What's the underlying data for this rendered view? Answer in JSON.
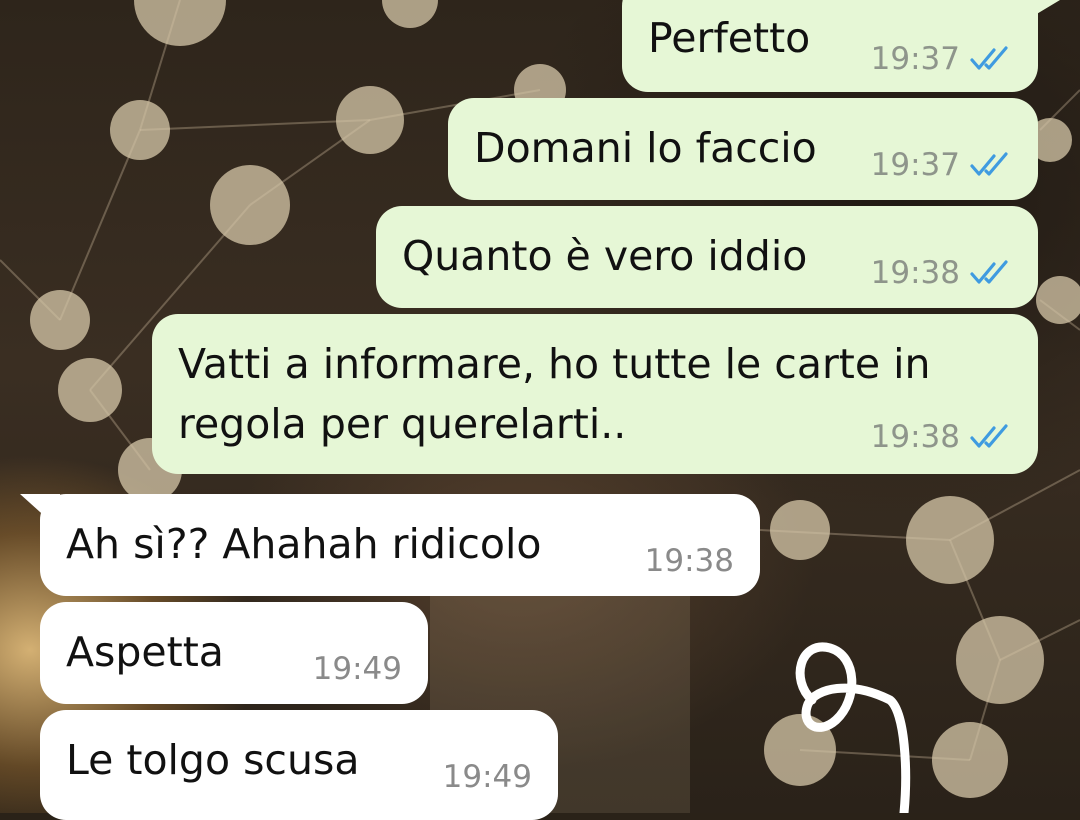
{
  "conversation": {
    "messages": [
      {
        "direction": "outgoing",
        "text": "Perfetto",
        "time": "19:37",
        "status": "read"
      },
      {
        "direction": "outgoing",
        "text": "Domani lo faccio",
        "time": "19:37",
        "status": "read"
      },
      {
        "direction": "outgoing",
        "text": "Quanto è vero iddio",
        "time": "19:38",
        "status": "read"
      },
      {
        "direction": "outgoing",
        "text_line1": "Vatti a informare, ho tutte le carte in",
        "text_line2": "regola per querelarti..",
        "time": "19:38",
        "status": "read"
      },
      {
        "direction": "incoming",
        "text": "Ah sì?? Ahahah ridicolo",
        "time": "19:38"
      },
      {
        "direction": "incoming",
        "text": "Aspetta",
        "time": "19:49"
      },
      {
        "direction": "incoming",
        "text": "Le tolgo scusa",
        "time": "19:49"
      }
    ]
  },
  "theme": {
    "outgoing_bubble": "#e6f7d6",
    "incoming_bubble": "#ffffff",
    "read_ticks": "#3f9be0",
    "timestamp": "#8e958b"
  },
  "icons": {
    "read_status": "double-check-icon",
    "drawing": "handwritten-q-scribble"
  }
}
